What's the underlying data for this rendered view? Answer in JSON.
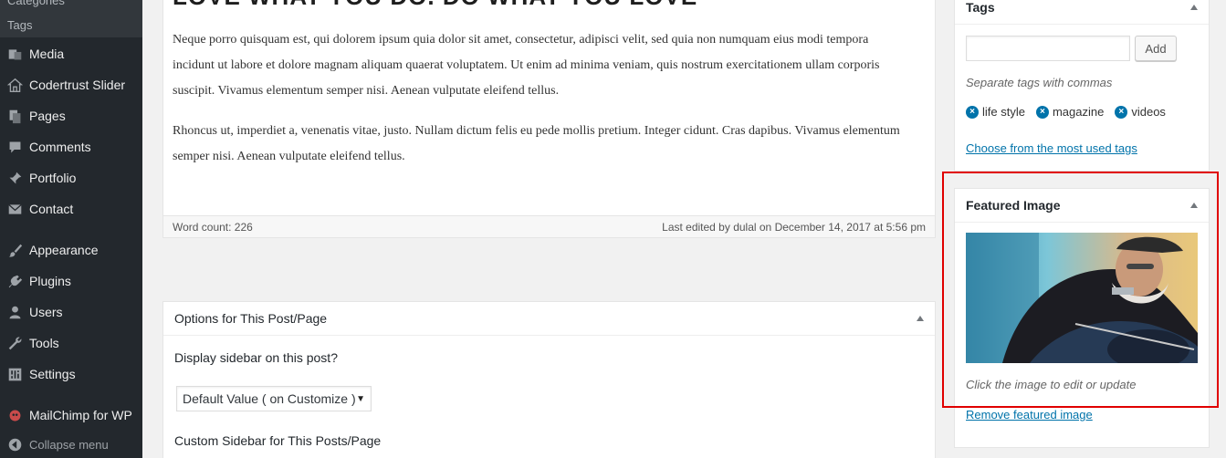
{
  "sidebar": {
    "submenu": [
      "Categories",
      "Tags"
    ],
    "items": [
      {
        "label": "Media",
        "icon": "media-icon"
      },
      {
        "label": "Codertrust Slider",
        "icon": "home-icon"
      },
      {
        "label": "Pages",
        "icon": "pages-icon"
      },
      {
        "label": "Comments",
        "icon": "comments-icon"
      },
      {
        "label": "Portfolio",
        "icon": "pin-icon"
      },
      {
        "label": "Contact",
        "icon": "mail-icon"
      },
      {
        "label": "Appearance",
        "icon": "brush-icon"
      },
      {
        "label": "Plugins",
        "icon": "plugins-icon"
      },
      {
        "label": "Users",
        "icon": "users-icon"
      },
      {
        "label": "Tools",
        "icon": "wrench-icon"
      },
      {
        "label": "Settings",
        "icon": "settings-icon"
      },
      {
        "label": "MailChimp for WP",
        "icon": "mailchimp-icon"
      },
      {
        "label": "Collapse menu",
        "icon": "collapse-icon"
      }
    ]
  },
  "editor": {
    "heading": "LOVE WHAT YOU DO. DO WHAT YOU LOVE",
    "paragraph1": "Neque porro quisquam est, qui dolorem ipsum quia dolor sit amet, consectetur, adipisci velit, sed quia non numquam eius modi tempora incidunt ut labore et dolore magnam aliquam quaerat voluptatem. Ut enim ad minima veniam, quis nostrum exercitationem ullam corporis suscipit. Vivamus elementum semper nisi. Aenean vulputate eleifend tellus.",
    "paragraph2": "Rhoncus ut, imperdiet a, venenatis vitae, justo. Nullam dictum felis eu pede mollis pretium. Integer cidunt. Cras dapibus. Vivamus elementum semper nisi. Aenean vulputate eleifend tellus.",
    "word_count": "Word count: 226",
    "last_edited": "Last edited by dulal on December 14, 2017 at 5:56 pm"
  },
  "options": {
    "title": "Options for This Post/Page",
    "display_sidebar_label": "Display sidebar on this post?",
    "select_value": "Default Value ( on Customize )",
    "custom_sidebar_label": "Custom Sidebar for This Posts/Page"
  },
  "tags": {
    "title": "Tags",
    "add_label": "Add",
    "hint": "Separate tags with commas",
    "list": [
      "life style",
      "magazine",
      "videos"
    ],
    "choose_link": "Choose from the most used tags"
  },
  "featured": {
    "title": "Featured Image",
    "hint": "Click the image to edit or update",
    "remove_link": "Remove featured image"
  },
  "colors": {
    "sidebar_bg": "#23282d",
    "link": "#0073aa",
    "highlight": "#e00000"
  }
}
